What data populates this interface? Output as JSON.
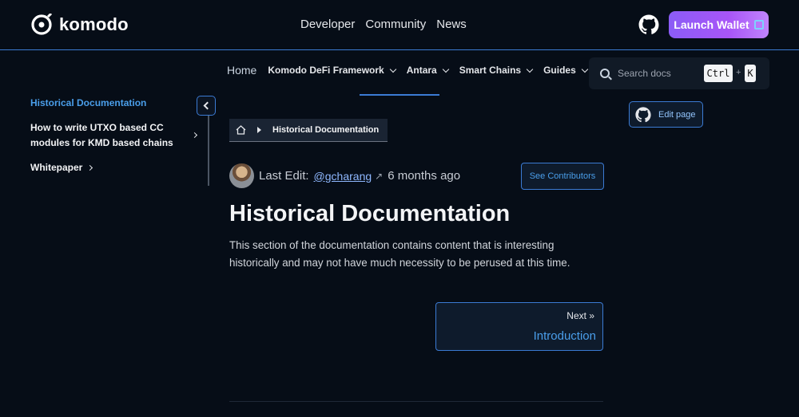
{
  "header": {
    "brand": "komodo",
    "nav": [
      "Developer",
      "Community",
      "News"
    ],
    "launch_label": "Launch Wallet",
    "accent_color": "#3b7bd4",
    "launch_gradient": [
      "#8b5cf6",
      "#c084fc"
    ]
  },
  "secnav": {
    "home": "Home",
    "items": [
      "Komodo DeFi Framework",
      "Antara",
      "Smart Chains",
      "Guides"
    ]
  },
  "search": {
    "placeholder": "Search docs",
    "key_ctrl": "Ctrl",
    "key_plus": "+",
    "key_k": "K"
  },
  "sidebar": {
    "active": "Historical Documentation",
    "items": [
      "How to write UTXO based CC modules for KMD based chains",
      "Whitepaper"
    ]
  },
  "breadcrumb": {
    "current": "Historical Documentation"
  },
  "meta": {
    "last_edit_label": "Last Edit:",
    "author": "@gcharang",
    "time": "6 months ago",
    "contributors_label": "See Contributors"
  },
  "article": {
    "title": "Historical Documentation",
    "body": "This section of the documentation contains content that is interesting historically and may not have much necessity to be perused at this time."
  },
  "pagination": {
    "next_label": "Next",
    "next_page": "Introduction"
  },
  "edit_page_label": "Edit page"
}
